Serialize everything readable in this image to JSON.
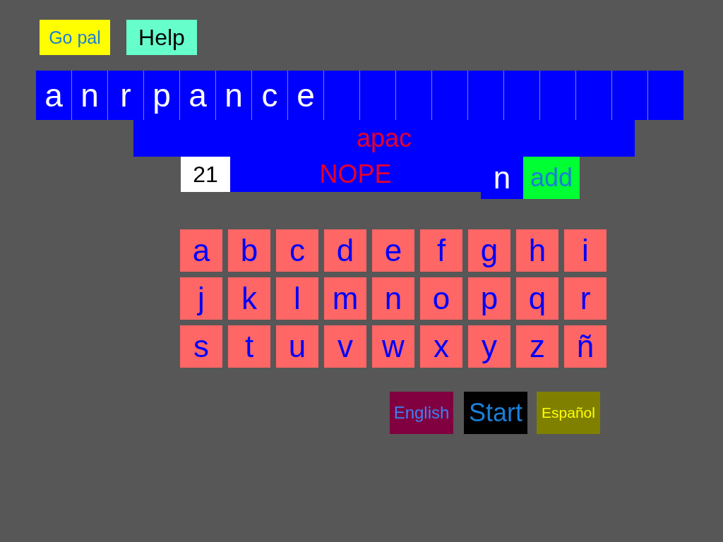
{
  "top_buttons": [
    {
      "label": "Go pal",
      "kind": "gopal"
    },
    {
      "label": "Help",
      "kind": "help"
    }
  ],
  "letter_slots": [
    "a",
    "n",
    "r",
    "p",
    "a",
    "n",
    "c",
    "e"
  ],
  "current_word": "apac",
  "score": "21",
  "message": "NOPE",
  "selected_letter": "n",
  "add_button": "add",
  "keyboard": [
    [
      "a",
      "b",
      "c",
      "d",
      "e",
      "f",
      "g",
      "h",
      "i"
    ],
    [
      "j",
      "k",
      "l",
      "m",
      "n",
      "o",
      "p",
      "q",
      "r"
    ],
    [
      "s",
      "t",
      "u",
      "v",
      "w",
      "x",
      "y",
      "z",
      "ñ"
    ]
  ],
  "bottom_buttons": [
    {
      "label": "English",
      "kind": "english"
    },
    {
      "label": "Start",
      "kind": "start"
    },
    {
      "label": "Español",
      "kind": "spanish"
    }
  ]
}
